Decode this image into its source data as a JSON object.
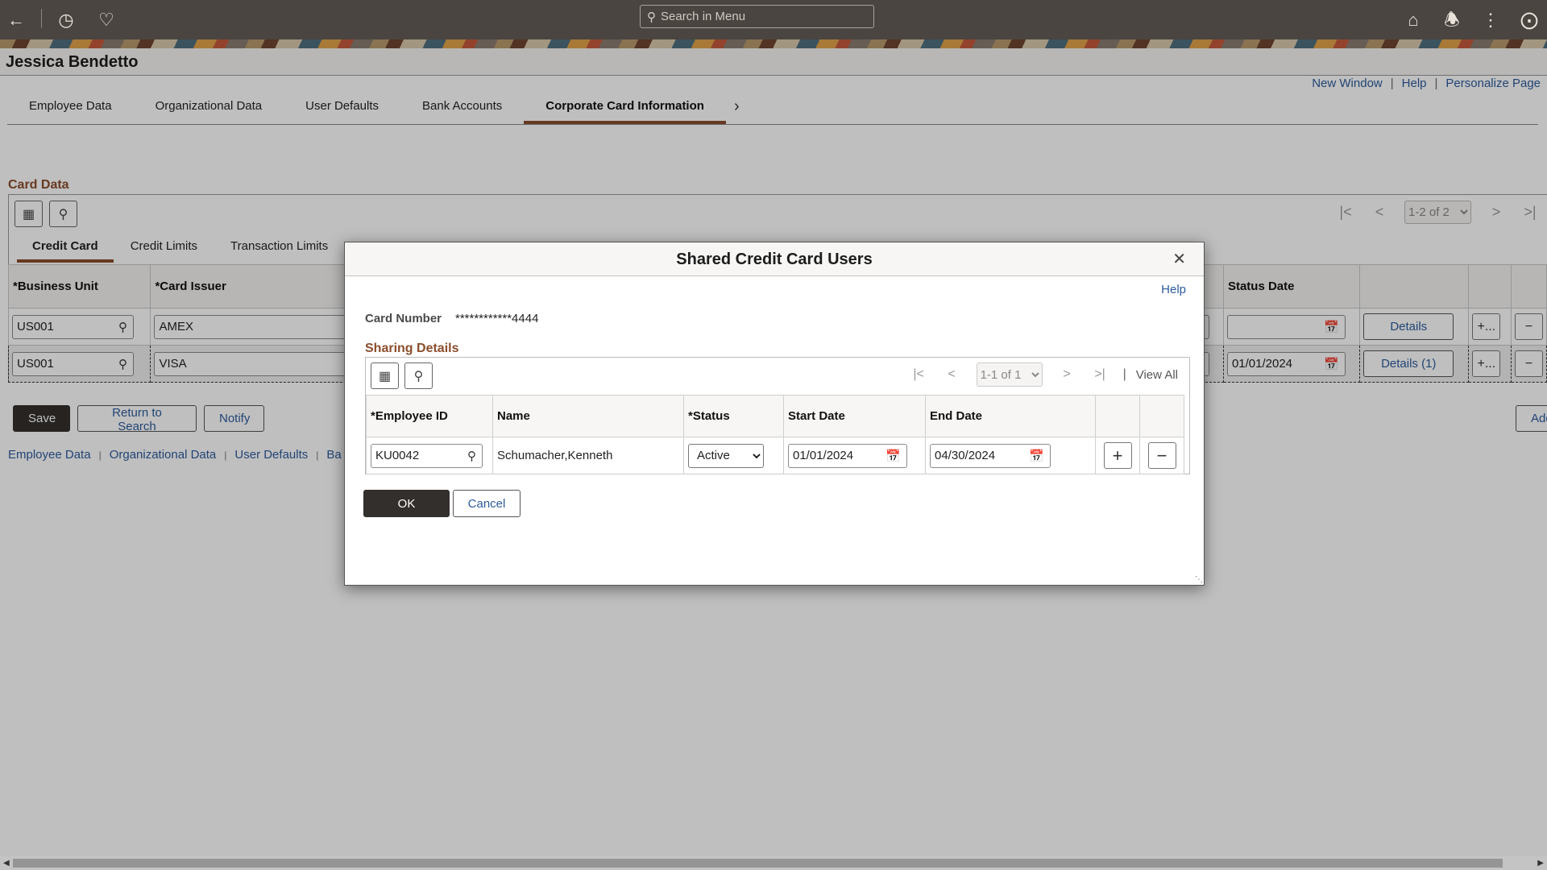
{
  "topbar": {
    "back_icon": "arrow-left-icon",
    "recent_icon": "clock-icon",
    "favorites_icon": "heart-icon",
    "search_placeholder": "Search in Menu",
    "home_icon": "home-icon",
    "notifications_icon": "bell-icon",
    "actions_icon": "kebab-icon",
    "navigator_icon": "compass-icon"
  },
  "header": {
    "employee_name": "Jessica Bendetto"
  },
  "page_links": [
    "New Window",
    "Help",
    "Personalize Page"
  ],
  "tabs": [
    {
      "label": "Employee Data",
      "active": false
    },
    {
      "label": "Organizational Data",
      "active": false
    },
    {
      "label": "User Defaults",
      "active": false
    },
    {
      "label": "Bank Accounts",
      "active": false
    },
    {
      "label": "Corporate Card Information",
      "active": true
    }
  ],
  "card_data": {
    "title": "Card Data",
    "pager": "1-2 of 2",
    "subtabs": [
      {
        "label": "Credit Card",
        "active": true
      },
      {
        "label": "Credit Limits",
        "active": false
      },
      {
        "label": "Transaction Limits",
        "active": false
      }
    ],
    "columns": {
      "business_unit": "*Business Unit",
      "card_issuer": "*Card Issuer",
      "status_date": "Status Date"
    },
    "rows": [
      {
        "business_unit": "US001",
        "card_issuer": "AMEX",
        "status_date": "",
        "details": "Details",
        "add": "+...",
        "delete": "−"
      },
      {
        "business_unit": "US001",
        "card_issuer": "VISA",
        "status_date": "01/01/2024",
        "details": "Details (1)",
        "add": "+...",
        "delete": "−"
      }
    ]
  },
  "actions": {
    "save": "Save",
    "return_to_search": "Return to Search",
    "notify": "Notify",
    "add_partial": "Add"
  },
  "footer_links": [
    "Employee Data",
    "Organizational Data",
    "User Defaults",
    "Ba"
  ],
  "dialog": {
    "title": "Shared Credit Card Users",
    "help": "Help",
    "card_number_label": "Card Number",
    "card_number_value": "************4444",
    "section_title": "Sharing Details",
    "pager": "1-1 of 1",
    "view_all": "View All",
    "columns": {
      "employee_id": "*Employee ID",
      "name": "Name",
      "status": "*Status",
      "start_date": "Start Date",
      "end_date": "End Date"
    },
    "rows": [
      {
        "employee_id": "KU0042",
        "name": "Schumacher,Kenneth",
        "status": "Active",
        "start_date": "01/01/2024",
        "end_date": "04/30/2024"
      }
    ],
    "status_options": [
      "Active"
    ],
    "ok": "OK",
    "cancel": "Cancel"
  },
  "colors": {
    "topbar": "#4a4540",
    "accent": "#8b4d2c",
    "link": "#2c5b9c",
    "primary_button": "#332f2c"
  }
}
